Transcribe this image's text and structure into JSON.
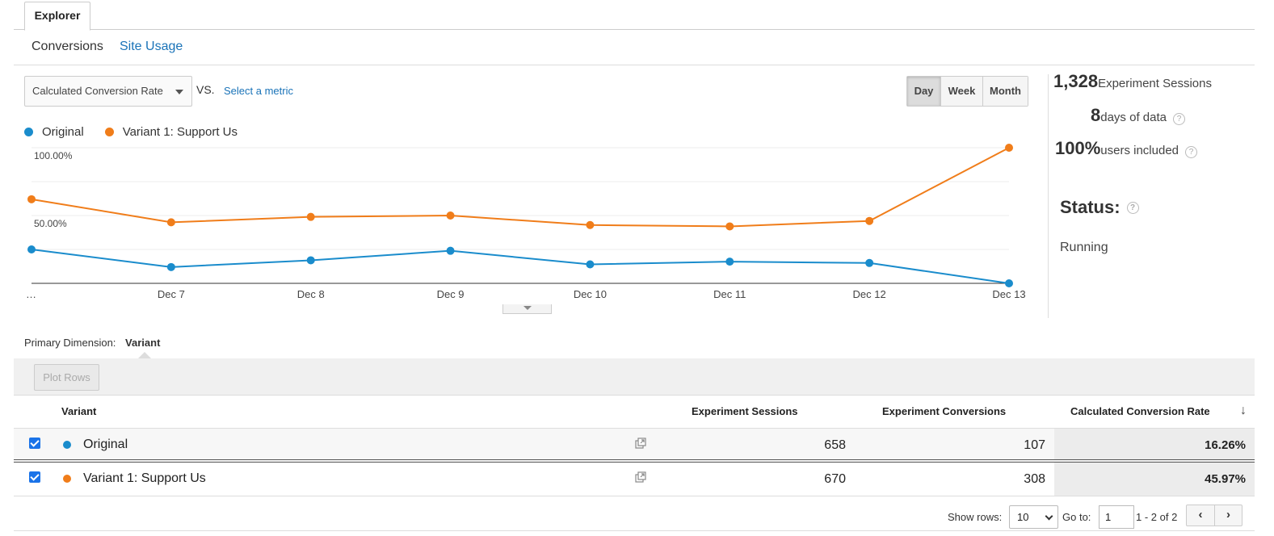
{
  "tabs": {
    "explorer": "Explorer"
  },
  "subtabs": {
    "conversions": "Conversions",
    "site_usage": "Site Usage"
  },
  "controls": {
    "metric": "Calculated Conversion Rate",
    "vs": "VS.",
    "select_metric": "Select a metric",
    "periods": [
      "Day",
      "Week",
      "Month"
    ],
    "active_period": "Day"
  },
  "legend": [
    {
      "name": "Original",
      "color": "#1a8ccc"
    },
    {
      "name": "Variant 1: Support Us",
      "color": "#f07d1a"
    }
  ],
  "chart_data": {
    "type": "line",
    "x": [
      "…",
      "Dec 7",
      "Dec 8",
      "Dec 9",
      "Dec 10",
      "Dec 11",
      "Dec 12",
      "Dec 13"
    ],
    "y_tick_labels": [
      "100.00%",
      "50.00%"
    ],
    "ylim": [
      0,
      100
    ],
    "series": [
      {
        "name": "Original",
        "color": "#1a8ccc",
        "values": [
          25,
          12,
          17,
          24,
          14,
          16,
          15,
          0
        ]
      },
      {
        "name": "Variant 1: Support Us",
        "color": "#f07d1a",
        "values": [
          62,
          45,
          49,
          50,
          43,
          42,
          46,
          100
        ]
      }
    ]
  },
  "summary": {
    "sessions_value": "1,328",
    "sessions_label": "Experiment Sessions",
    "days_value": "8",
    "days_label": "days of data",
    "users_value": "100%",
    "users_label": "users included",
    "status_title": "Status:",
    "status_value": "Running",
    "help_glyph": "?"
  },
  "primary_dimension": {
    "label": "Primary Dimension:",
    "value": "Variant"
  },
  "toolbar": {
    "plot_rows": "Plot Rows"
  },
  "table": {
    "headers": {
      "variant": "Variant",
      "sessions": "Experiment Sessions",
      "conversions": "Experiment Conversions",
      "rate": "Calculated Conversion Rate",
      "sort_glyph": "↓"
    },
    "rows": [
      {
        "name": "Original",
        "color": "#1a8ccc",
        "sessions": "658",
        "conversions": "107",
        "rate": "16.26%"
      },
      {
        "name": "Variant 1: Support Us",
        "color": "#f07d1a",
        "sessions": "670",
        "conversions": "308",
        "rate": "45.97%"
      }
    ]
  },
  "pagination": {
    "show_rows_label": "Show rows:",
    "rows_value": "10",
    "goto_label": "Go to:",
    "goto_value": "1",
    "range": "1 - 2 of 2",
    "prev_glyph": "‹",
    "next_glyph": "›"
  }
}
